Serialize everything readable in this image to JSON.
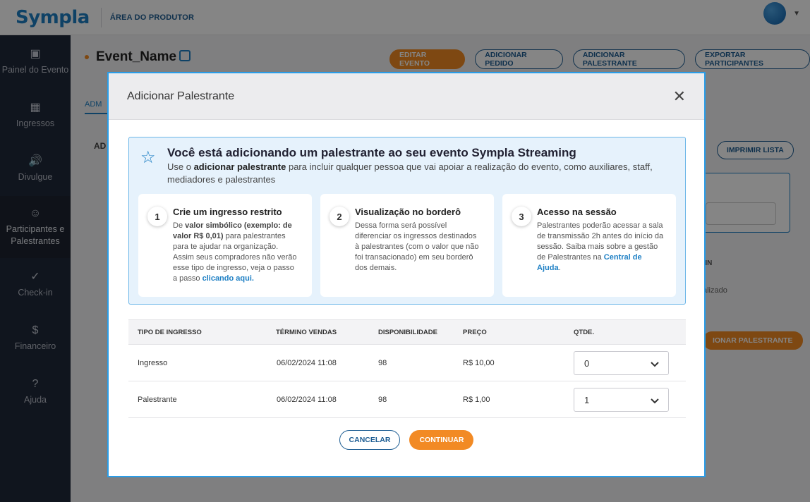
{
  "header": {
    "logo": "Sympla",
    "area_label": "ÁREA DO PRODUTOR"
  },
  "sidebar": {
    "items": [
      {
        "label": "Painel do Evento",
        "icon": "monitor-icon"
      },
      {
        "label": "Ingressos",
        "icon": "ticket-icon"
      },
      {
        "label": "Divulgue",
        "icon": "megaphone-icon"
      },
      {
        "label": "Participantes e Palestrantes",
        "icon": "people-icon"
      },
      {
        "label": "Check-in",
        "icon": "check-circle-icon"
      },
      {
        "label": "Financeiro",
        "icon": "dollar-circle-icon"
      },
      {
        "label": "Ajuda",
        "icon": "help-circle-icon"
      }
    ]
  },
  "event": {
    "name": "Event_Name",
    "buttons": {
      "edit": "EDITAR EVENTO",
      "add_order": "ADICIONAR PEDIDO",
      "add_speaker": "ADICIONAR PALESTRANTE",
      "export": "EXPORTAR PARTICIPANTES"
    },
    "tab": "ADM",
    "section": "AD",
    "print_list": "IMPRIMIR LISTA",
    "checkin_col": "-IN",
    "checkin_status": "alizado",
    "add_speaker_bottom": "IONAR PALESTRANTE"
  },
  "modal": {
    "title": "Adicionar Palestrante",
    "info": {
      "title": "Você está adicionando um palestrante ao seu evento Sympla Streaming",
      "desc_pre": "Use o ",
      "desc_bold": "adicionar palestrante",
      "desc_post": " para incluir qualquer pessoa que vai apoiar a realização do evento, como auxiliares, staff, mediadores e palestrantes"
    },
    "cards": [
      {
        "num": "1",
        "title": "Crie um ingresso restrito",
        "t1": "De ",
        "b1": "valor simbólico (exemplo: de valor R$ 0,01)",
        "t2": " para palestrantes para te ajudar na organização. Assim seus compradores não verão esse tipo de ingresso, veja o passo a passo ",
        "link": "clicando aqui."
      },
      {
        "num": "2",
        "title": "Visualização no borderô",
        "t1": "Dessa forma será possível diferenciar os ingressos destinados à palestrantes (com o valor que não foi transacionado) em seu borderô dos demais."
      },
      {
        "num": "3",
        "title": "Acesso na sessão",
        "t1": "Palestrantes poderão acessar a sala de transmissão 2h antes do início da sessão. Saiba mais sobre a gestão de Palestrantes na ",
        "link": "Central de Ajuda",
        "t2": "."
      }
    ],
    "table": {
      "headers": [
        "TIPO DE INGRESSO",
        "TÉRMINO VENDAS",
        "DISPONIBILIDADE",
        "PREÇO",
        "QTDE."
      ],
      "rows": [
        {
          "type": "Ingresso",
          "end": "06/02/2024 11:08",
          "avail": "98",
          "price": "R$ 10,00",
          "qty": "0"
        },
        {
          "type": "Palestrante",
          "end": "06/02/2024 11:08",
          "avail": "98",
          "price": "R$ 1,00",
          "qty": "1"
        }
      ]
    },
    "cancel": "CANCELAR",
    "continue": "CONTINUAR"
  },
  "colors": {
    "brand_blue": "#1d7fc4",
    "accent_orange": "#f28a24",
    "sidebar_bg": "#20293a"
  }
}
